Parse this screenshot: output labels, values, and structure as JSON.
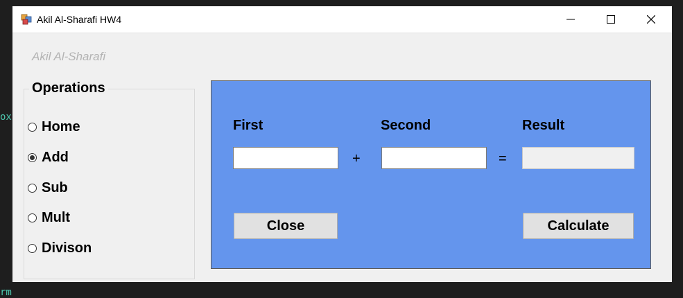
{
  "background": {
    "code_fragment_1": "ox",
    "code_fragment_2": "rm"
  },
  "window": {
    "title": "Akil Al-Sharafi HW4",
    "icon": "app-icon",
    "controls": [
      "minimize-icon",
      "maximize-icon",
      "close-icon"
    ]
  },
  "watermark": "Akil Al-Sharafi",
  "operations": {
    "legend": "Operations",
    "options": [
      {
        "label": "Home",
        "checked": false
      },
      {
        "label": "Add",
        "checked": true
      },
      {
        "label": "Sub",
        "checked": false
      },
      {
        "label": "Mult",
        "checked": false
      },
      {
        "label": "Divison",
        "checked": false
      }
    ]
  },
  "calculator": {
    "panel_color": "#6495ed",
    "first_label": "First",
    "second_label": "Second",
    "result_label": "Result",
    "first_value": "",
    "second_value": "",
    "result_value": "",
    "operator": "+",
    "equals": "=",
    "close_label": "Close",
    "calculate_label": "Calculate"
  }
}
